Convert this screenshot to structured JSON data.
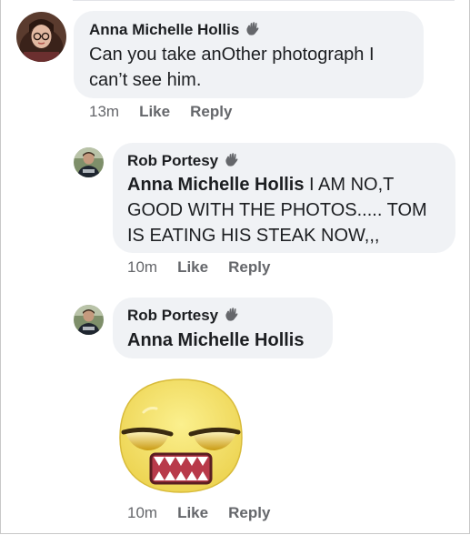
{
  "comments": [
    {
      "author": "Anna Michelle Hollis",
      "badge_icon": "wave-hand-icon",
      "text": "Can you take anOther photograph I can’t see him.",
      "time": "13m",
      "like": "Like",
      "reply": "Reply"
    },
    {
      "author": "Rob Portesy",
      "badge_icon": "wave-hand-icon",
      "mention": "Anna Michelle Hollis",
      "text": " I AM NO,T GOOD WITH THE PHOTOS..... TOM IS EATING HIS STEAK NOW,,,",
      "time": "10m",
      "like": "Like",
      "reply": "Reply"
    },
    {
      "author": "Rob Portesy",
      "badge_icon": "wave-hand-icon",
      "mention": "Anna Michelle Hollis",
      "sticker": "annoyed-face-sticker",
      "time": "10m",
      "like": "Like",
      "reply": "Reply"
    }
  ],
  "colors": {
    "bubble": "#f0f2f5",
    "meta_text": "#65676b",
    "sticker_face": "#f7e16a"
  }
}
